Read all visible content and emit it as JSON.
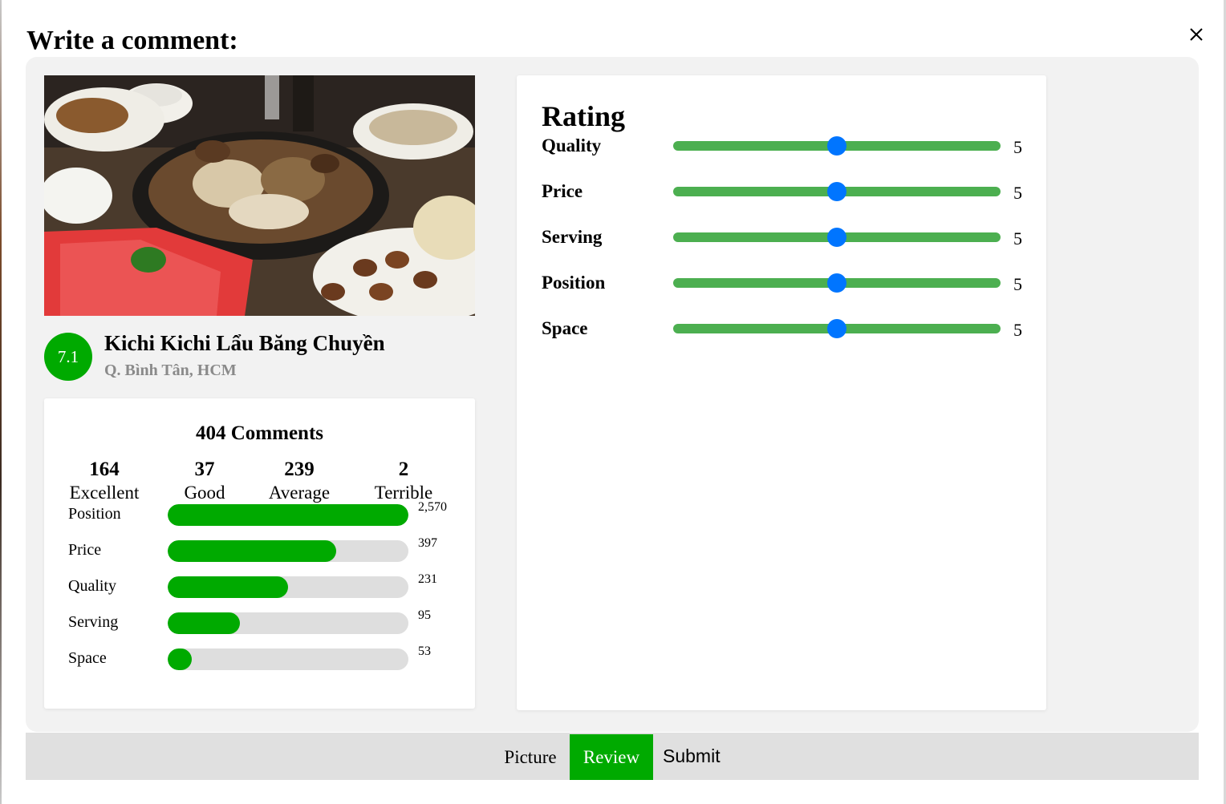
{
  "modal": {
    "title": "Write a comment:",
    "close_icon": "close-icon"
  },
  "restaurant": {
    "image_icon": "food-photo-hotpot",
    "score": "7.1",
    "name": "Kichi Kichi Lẩu Băng Chuyền",
    "address": "Q. Bình Tân, HCM"
  },
  "stats": {
    "title": "404 Comments",
    "summary": [
      {
        "count": "164",
        "label": "Excellent"
      },
      {
        "count": "37",
        "label": "Good"
      },
      {
        "count": "239",
        "label": "Average"
      },
      {
        "count": "2",
        "label": "Terrible"
      }
    ],
    "bars": [
      {
        "label": "Position",
        "value": "2,570",
        "fraction": 1.0
      },
      {
        "label": "Price",
        "value": "397",
        "fraction": 0.7
      },
      {
        "label": "Quality",
        "value": "231",
        "fraction": 0.5
      },
      {
        "label": "Serving",
        "value": "95",
        "fraction": 0.3
      },
      {
        "label": "Space",
        "value": "53",
        "fraction": 0.1
      }
    ]
  },
  "rating": {
    "title": "Rating",
    "sliders": [
      {
        "label": "Quality",
        "value": "5",
        "min": 0,
        "max": 10
      },
      {
        "label": "Price",
        "value": "5",
        "min": 0,
        "max": 10
      },
      {
        "label": "Serving",
        "value": "5",
        "min": 0,
        "max": 10
      },
      {
        "label": "Position",
        "value": "5",
        "min": 0,
        "max": 10
      },
      {
        "label": "Space",
        "value": "5",
        "min": 0,
        "max": 10
      }
    ]
  },
  "footer": {
    "tabs": [
      {
        "label": "Picture",
        "active": false
      },
      {
        "label": "Review",
        "active": true
      }
    ],
    "submit_label": "Submit"
  },
  "colors": {
    "accent_green": "#00aa00",
    "slider_green": "#4caf50",
    "slider_thumb": "#0075ff",
    "panel_bg": "#f2f2f2",
    "footer_bg": "#e0e0e0"
  }
}
